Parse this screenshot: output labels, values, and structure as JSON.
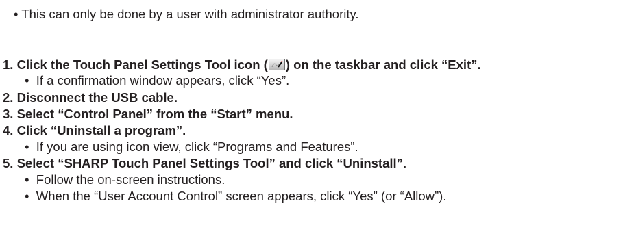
{
  "note": "• This can only be done by a user with administrator authority.",
  "steps": [
    {
      "number": "1.",
      "text_before_icon": "Click the Touch Panel Settings Tool icon (",
      "text_after_icon": ") on the taskbar and click “Exit”.",
      "icon": "touch-panel-settings-tool-icon",
      "bullets": [
        "If a confirmation window appears, click “Yes”."
      ]
    },
    {
      "number": "2.",
      "text": "Disconnect the USB cable.",
      "bullets": []
    },
    {
      "number": "3.",
      "text": "Select “Control Panel” from the “Start” menu.",
      "bullets": []
    },
    {
      "number": "4.",
      "text": "Click “Uninstall a program”.",
      "bullets": [
        "If you are using icon view, click “Programs and Features”."
      ]
    },
    {
      "number": "5.",
      "text": "Select “SHARP Touch Panel Settings Tool” and click “Uninstall”.",
      "bullets": [
        "Follow the on-screen instructions.",
        "When the “User Account Control” screen appears, click “Yes” (or “Allow”)."
      ]
    }
  ],
  "bullet_glyph": "•"
}
